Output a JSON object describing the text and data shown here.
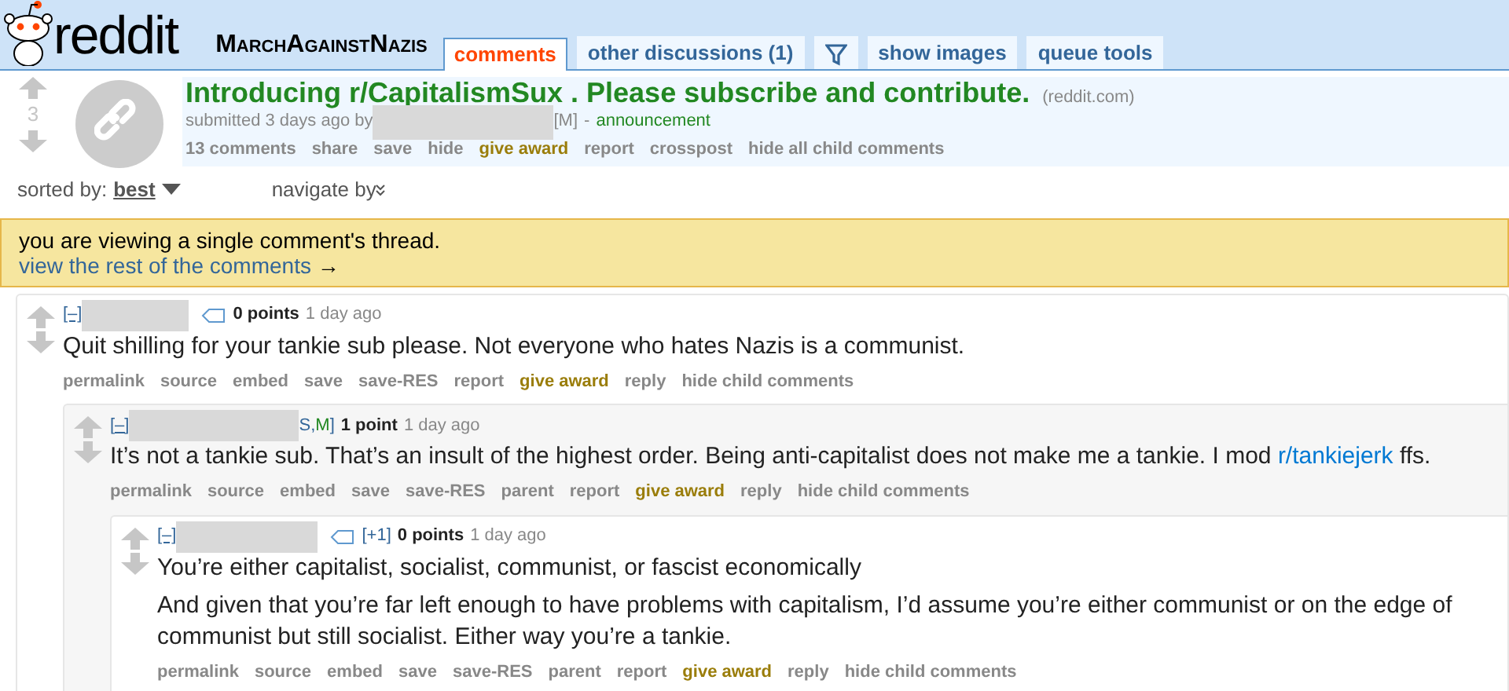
{
  "header": {
    "logo_text": "reddit",
    "subreddit": "MarchAgainstNazis",
    "tabs": [
      {
        "kind": "text",
        "label": "comments",
        "selected": true
      },
      {
        "kind": "text",
        "label": "other discussions (1)",
        "selected": false
      },
      {
        "kind": "filter",
        "selected": false
      },
      {
        "kind": "text",
        "label": "show images",
        "selected": false
      },
      {
        "kind": "text",
        "label": "queue tools",
        "selected": false
      }
    ]
  },
  "post": {
    "score": "3",
    "title": "Introducing r/CapitalismSux . Please subscribe and contribute.",
    "domain": "(reddit.com)",
    "submitted": "submitted 3 days ago by",
    "flair": "[M]",
    "separator": "-",
    "tag": "announcement",
    "actions": [
      {
        "kind": "plain",
        "label": "13 comments"
      },
      {
        "kind": "plain",
        "label": "share"
      },
      {
        "kind": "plain",
        "label": "save"
      },
      {
        "kind": "plain",
        "label": "hide"
      },
      {
        "kind": "award",
        "label": "give award"
      },
      {
        "kind": "plain",
        "label": "report"
      },
      {
        "kind": "plain",
        "label": "crosspost"
      },
      {
        "kind": "plain",
        "label": "hide all child comments"
      }
    ]
  },
  "sort": {
    "label": "sorted by:",
    "value": "best",
    "navigate": "navigate by"
  },
  "notice": {
    "text": "you are viewing a single comment's thread.",
    "link": "view the rest of the comments",
    "arrow": "→"
  },
  "comments": [
    {
      "toggle": "[–]",
      "has_tag": true,
      "points": "0 points",
      "time": "1 day ago",
      "body": [
        [
          {
            "kind": "text",
            "text": "Quit shilling for your tankie sub please. Not everyone who hates Nazis is a communist."
          }
        ]
      ],
      "actions": [
        {
          "kind": "plain",
          "label": "permalink"
        },
        {
          "kind": "plain",
          "label": "source"
        },
        {
          "kind": "plain",
          "label": "embed"
        },
        {
          "kind": "plain",
          "label": "save"
        },
        {
          "kind": "plain",
          "label": "save-RES"
        },
        {
          "kind": "plain",
          "label": "report"
        },
        {
          "kind": "award",
          "label": "give award"
        },
        {
          "kind": "plain",
          "label": "reply"
        },
        {
          "kind": "plain",
          "label": "hide child comments"
        }
      ],
      "children": [
        {
          "toggle": "[–]",
          "flair": [
            {
              "text": "S",
              "color": "#336699"
            },
            {
              "text": ",",
              "color": "#336699"
            },
            {
              "text": "M",
              "color": "#228822"
            },
            {
              "text": "]",
              "color": "#336699"
            }
          ],
          "has_tag": false,
          "points": "1 point",
          "time": "1 day ago",
          "body": [
            [
              {
                "kind": "text",
                "text": "It’s not a tankie sub. That’s an insult of the highest order. Being anti-capitalist does not make me a tankie. I mod "
              },
              {
                "kind": "link",
                "text": "r/tankiejerk"
              },
              {
                "kind": "text",
                "text": " ffs."
              }
            ]
          ],
          "actions": [
            {
              "kind": "plain",
              "label": "permalink"
            },
            {
              "kind": "plain",
              "label": "source"
            },
            {
              "kind": "plain",
              "label": "embed"
            },
            {
              "kind": "plain",
              "label": "save"
            },
            {
              "kind": "plain",
              "label": "save-RES"
            },
            {
              "kind": "plain",
              "label": "parent"
            },
            {
              "kind": "plain",
              "label": "report"
            },
            {
              "kind": "award",
              "label": "give award"
            },
            {
              "kind": "plain",
              "label": "reply"
            },
            {
              "kind": "plain",
              "label": "hide child comments"
            }
          ],
          "children": [
            {
              "toggle": "[–]",
              "has_tag": true,
              "extra": "[+1]",
              "points": "0 points",
              "time": "1 day ago",
              "body": [
                [
                  {
                    "kind": "text",
                    "text": "You’re either capitalist, socialist, communist, or fascist economically"
                  }
                ],
                [
                  {
                    "kind": "text",
                    "text": "And given that you’re far left enough to have problems with capitalism, I’d assume you’re either communist or on the edge of communist but still socialist. Either way you’re a tankie."
                  }
                ]
              ],
              "actions": [
                {
                  "kind": "plain",
                  "label": "permalink"
                },
                {
                  "kind": "plain",
                  "label": "source"
                },
                {
                  "kind": "plain",
                  "label": "embed"
                },
                {
                  "kind": "plain",
                  "label": "save"
                },
                {
                  "kind": "plain",
                  "label": "save-RES"
                },
                {
                  "kind": "plain",
                  "label": "parent"
                },
                {
                  "kind": "plain",
                  "label": "report"
                },
                {
                  "kind": "award",
                  "label": "give award"
                },
                {
                  "kind": "plain",
                  "label": "reply"
                },
                {
                  "kind": "plain",
                  "label": "hide child comments"
                }
              ]
            }
          ]
        }
      ]
    }
  ]
}
